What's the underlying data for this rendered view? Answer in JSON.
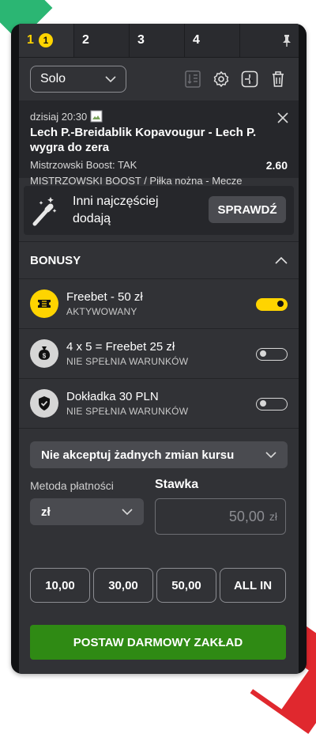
{
  "tabs": [
    {
      "label": "1",
      "badge": "1"
    },
    {
      "label": "2"
    },
    {
      "label": "3"
    },
    {
      "label": "4"
    }
  ],
  "toolbar": {
    "mode": "Solo"
  },
  "event": {
    "date": "dzisiaj 20:30",
    "title": "Lech P.-Breidablik Kopavougur - Lech P. wygra do zera",
    "boost": "Mistrzowski Boost: TAK",
    "odds": "2.60",
    "category": "MISTRZOWSKI BOOST / Piłka nożna - Mecze"
  },
  "suggestion": {
    "text": "Inni najczęściej dodają",
    "button": "SPRAWDŹ"
  },
  "bonuses": {
    "heading": "BONUSY",
    "items": [
      {
        "title": "Freebet - 50 zł",
        "status": "AKTYWOWANY",
        "active": true
      },
      {
        "title": "4 x 5 = Freebet 25 zł",
        "status": "NIE SPEŁNIA WARUNKÓW",
        "active": false
      },
      {
        "title": "Dokładka 30 PLN",
        "status": "NIE SPEŁNIA WARUNKÓW",
        "active": false
      }
    ]
  },
  "odds_change": {
    "selected": "Nie akceptuj żadnych zmian kursu"
  },
  "payment": {
    "label": "Metoda płatności",
    "selected": "zł"
  },
  "stake": {
    "label": "Stawka",
    "placeholder": "50,00",
    "currency": "zł"
  },
  "quick_stakes": [
    "10,00",
    "30,00",
    "50,00",
    "ALL IN"
  ],
  "submit": {
    "label": "POSTAW DARMOWY ZAKŁAD"
  },
  "colors": {
    "accent": "#ffd400",
    "submit": "#2f8a14",
    "panel": "#313236"
  }
}
